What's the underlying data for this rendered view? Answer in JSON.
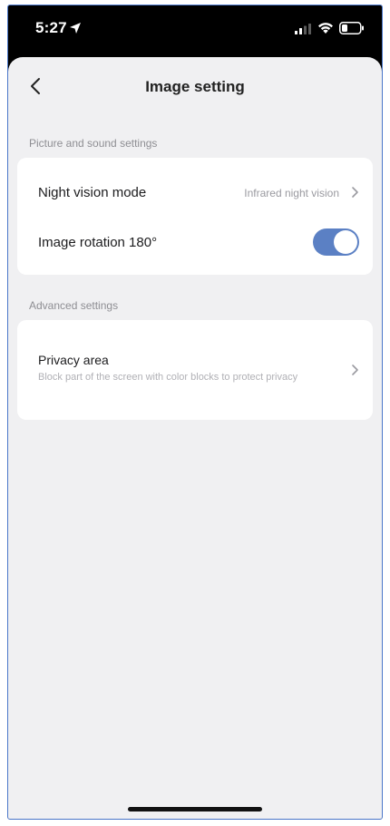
{
  "status_bar": {
    "time": "5:27",
    "icons": [
      "location-arrow-icon",
      "cellular-signal-icon",
      "wifi-icon",
      "battery-icon"
    ]
  },
  "nav": {
    "title": "Image setting",
    "back_icon": "chevron-left-icon"
  },
  "sections": {
    "picture_sound": {
      "header": "Picture and sound settings",
      "night_vision": {
        "label": "Night vision mode",
        "value": "Infrared night vision"
      },
      "image_rotation": {
        "label": "Image rotation 180°",
        "toggle_on": true
      }
    },
    "advanced": {
      "header": "Advanced settings",
      "privacy_area": {
        "label": "Privacy area",
        "description": "Block part of the screen with color blocks to protect privacy"
      }
    }
  },
  "colors": {
    "toggle_on": "#5b80c4",
    "background": "#f0f0f2",
    "card": "#ffffff"
  }
}
